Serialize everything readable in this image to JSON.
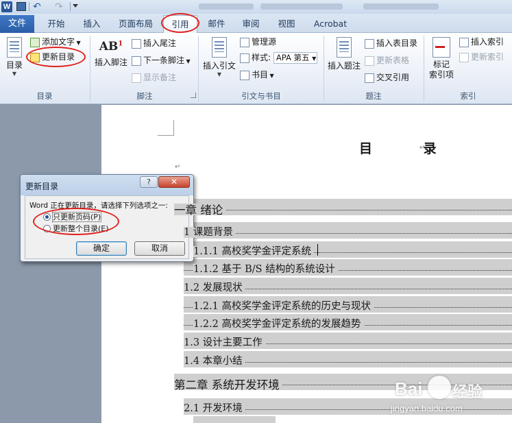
{
  "quick_access": {
    "app_logo": "W",
    "icons": [
      "word-logo-icon",
      "save-icon",
      "undo-icon",
      "redo-icon",
      "customize-icon"
    ]
  },
  "tabs": {
    "file": "文件",
    "items": [
      "开始",
      "插入",
      "页面布局",
      "引用",
      "邮件",
      "审阅",
      "视图",
      "Acrobat"
    ],
    "active": "引用"
  },
  "ribbon": {
    "toc_group": {
      "label": "目录",
      "toc_button": "目录",
      "add_text": "添加文字",
      "update_toc": "更新目录"
    },
    "footnote_group": {
      "label": "脚注",
      "insert_footnote": "插入脚注",
      "ab_icon_text": "AB",
      "ab_sup": "1",
      "insert_endnote": "插入尾注",
      "next_footnote": "下一条脚注",
      "show_notes": "显示备注"
    },
    "citation_group": {
      "label": "引文与书目",
      "insert_citation": "插入引文",
      "manage_sources": "管理源",
      "style_label": "样式:",
      "style_value": "APA 第五",
      "bibliography": "书目"
    },
    "caption_group": {
      "label": "题注",
      "insert_caption": "插入题注",
      "insert_table_of_figures": "插入表目录",
      "update_table": "更新表格",
      "cross_reference": "交叉引用"
    },
    "index_group": {
      "label": "索引",
      "mark_entry": "标记\n索引项",
      "insert_index": "插入索引",
      "update_index": "更新索引"
    }
  },
  "document": {
    "heading": "目  录",
    "paragraph_mark": "↵",
    "toc": [
      {
        "level": 1,
        "text": "一章  绪论"
      },
      {
        "level": 2,
        "text": "1 课题背景"
      },
      {
        "level": 3,
        "text": "1.1.1 高校奖学金评定系统"
      },
      {
        "level": 3,
        "text": "1.1.2 基于 B/S 结构的系统设计"
      },
      {
        "level": 2,
        "text": "1.2 发展现状"
      },
      {
        "level": 3,
        "text": "1.2.1 高校奖学金评定系统的历史与现状"
      },
      {
        "level": 3,
        "text": "1.2.2 高校奖学金评定系统的发展趋势"
      },
      {
        "level": 2,
        "text": "1.3 设计主要工作"
      },
      {
        "level": 2,
        "text": "1.4 本章小结"
      },
      {
        "level": 1,
        "text": "第二章  系统开发环境"
      },
      {
        "level": 2,
        "text": "2.1 开发环境"
      }
    ]
  },
  "dialog": {
    "title": "更新目录",
    "help": "?",
    "close": "✕",
    "message": "Word 正在更新目录，请选择下列选项之一:",
    "option_page_numbers": "只更新页码(P)",
    "option_entire_table": "更新整个目录(E)",
    "selected": "option_page_numbers",
    "ok": "确定",
    "cancel": "取消"
  },
  "watermark": {
    "logo": "Bai",
    "cn": "经验",
    "url": "jingyan.baidu.com"
  },
  "colors": {
    "annotation_red": "#e0201c",
    "file_tab_blue": "#2a5ea8",
    "toc_field_shading": "#cfcfcf"
  }
}
